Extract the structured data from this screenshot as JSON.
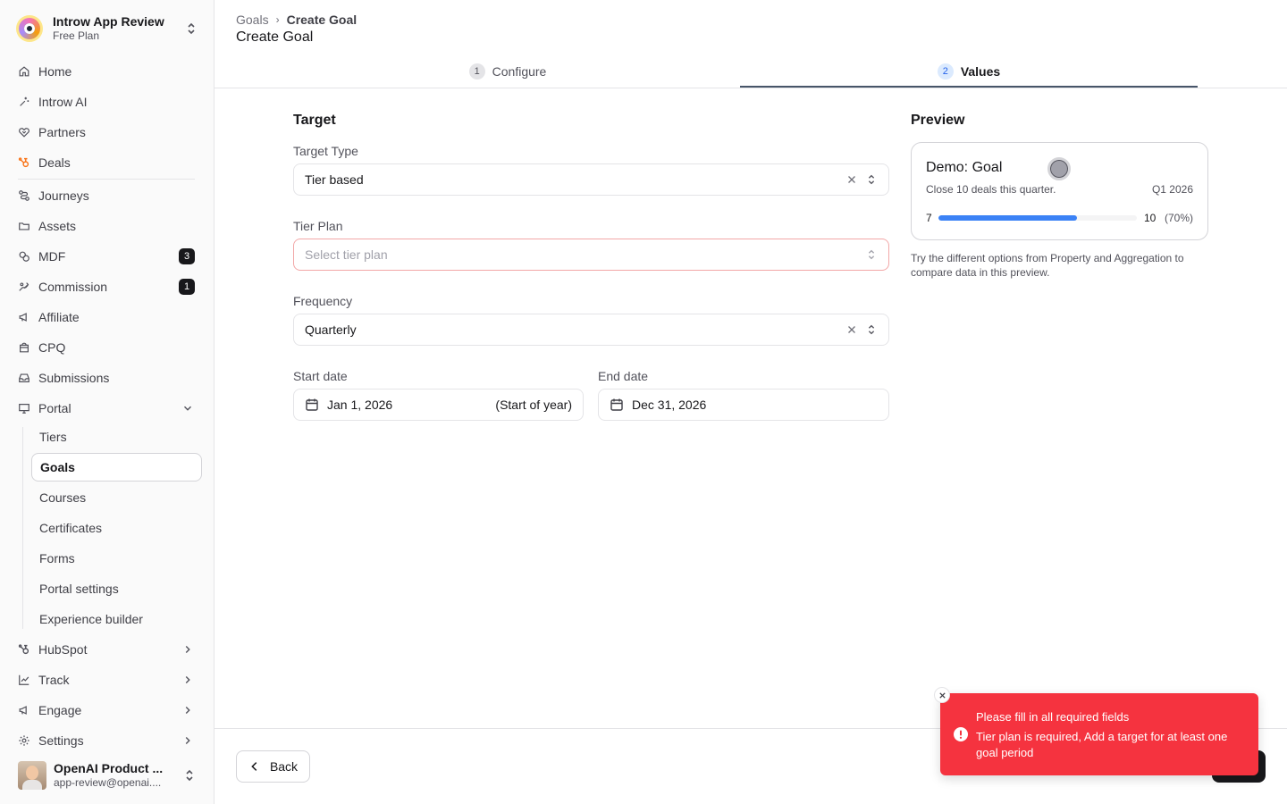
{
  "workspace": {
    "name": "Introw App Review",
    "plan": "Free Plan"
  },
  "nav": {
    "home": "Home",
    "introw_ai": "Introw AI",
    "partners": "Partners",
    "deals": "Deals",
    "journeys": "Journeys",
    "assets": "Assets",
    "mdf": "MDF",
    "mdf_badge": "3",
    "commission": "Commission",
    "commission_badge": "1",
    "affiliate": "Affiliate",
    "cpq": "CPQ",
    "submissions": "Submissions",
    "portal": "Portal",
    "portal_sub": [
      "Tiers",
      "Goals",
      "Courses",
      "Certificates",
      "Forms",
      "Portal settings",
      "Experience builder"
    ],
    "hubspot": "HubSpot",
    "track": "Track",
    "engage": "Engage",
    "settings": "Settings"
  },
  "user": {
    "name": "OpenAI Product ...",
    "email": "app-review@openai...."
  },
  "breadcrumb": {
    "parent": "Goals",
    "current": "Create Goal"
  },
  "page_title": "Create Goal",
  "tabs": [
    {
      "num": "1",
      "label": "Configure"
    },
    {
      "num": "2",
      "label": "Values"
    }
  ],
  "form": {
    "section": "Target",
    "target_type_label": "Target Type",
    "target_type_value": "Tier based",
    "tier_plan_label": "Tier Plan",
    "tier_plan_placeholder": "Select tier plan",
    "frequency_label": "Frequency",
    "frequency_value": "Quarterly",
    "start_label": "Start date",
    "start_value": "Jan 1, 2026",
    "start_hint": "(Start of year)",
    "end_label": "End date",
    "end_value": "Dec 31, 2026"
  },
  "preview": {
    "title": "Preview",
    "card_title": "Demo: Goal",
    "description": "Close 10 deals this quarter.",
    "period": "Q1 2026",
    "current": "7",
    "target": "10",
    "percent_label": "(70%)",
    "progress": 0.7,
    "hint": "Try the different options from Property and Aggregation to compare data in this preview."
  },
  "footer": {
    "back_label": "Back"
  },
  "toast": {
    "title": "Please fill in all required fields",
    "description": "Tier plan is required, Add a target for at least one goal period"
  },
  "colors": {
    "accent": "#3b82f6",
    "error": "#f5333f",
    "dark": "#18181b"
  }
}
